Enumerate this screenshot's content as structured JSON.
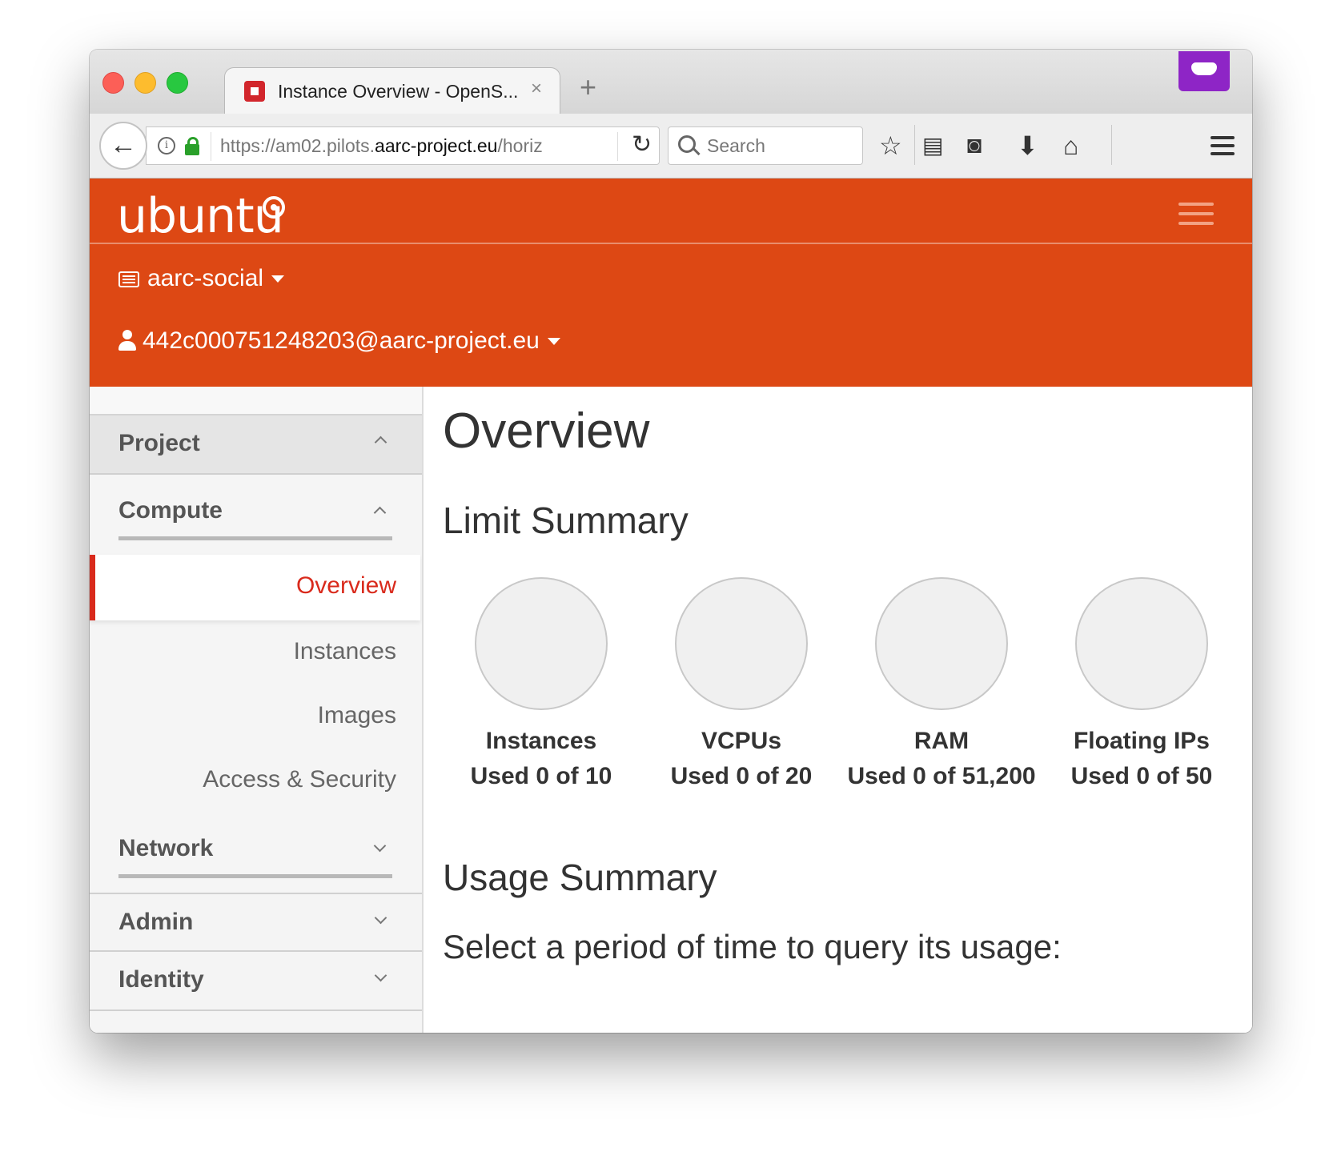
{
  "browser": {
    "tab_title": "Instance Overview - OpenS...",
    "tab_close": "×",
    "new_tab": "+",
    "url_prefix": "https://am02.pilots.",
    "url_domain": "aarc-project.eu",
    "url_suffix": "/horiz",
    "search_placeholder": "Search"
  },
  "header": {
    "logo": "ubuntu",
    "project": "aarc-social",
    "user": "442c000751248203@aarc-project.eu"
  },
  "sidebar": {
    "panels": {
      "project": "Project",
      "admin": "Admin",
      "identity": "Identity"
    },
    "groups": {
      "compute": "Compute",
      "network": "Network"
    },
    "items": [
      "Overview",
      "Instances",
      "Images",
      "Access & Security"
    ]
  },
  "main": {
    "title": "Overview",
    "limit_summary": "Limit Summary",
    "usage_summary": "Usage Summary",
    "query_prompt": "Select a period of time to query its usage:",
    "limits": [
      {
        "label": "Instances",
        "used": "Used 0 of 10"
      },
      {
        "label": "VCPUs",
        "used": "Used 0 of 20"
      },
      {
        "label": "RAM",
        "used": "Used 0 of 51,200"
      },
      {
        "label": "Floating IPs",
        "used": "Used 0 of 50"
      }
    ]
  },
  "colors": {
    "header_orange": "#dd4814",
    "active_red": "#d92a1c",
    "extension_purple": "#8e25c6"
  }
}
